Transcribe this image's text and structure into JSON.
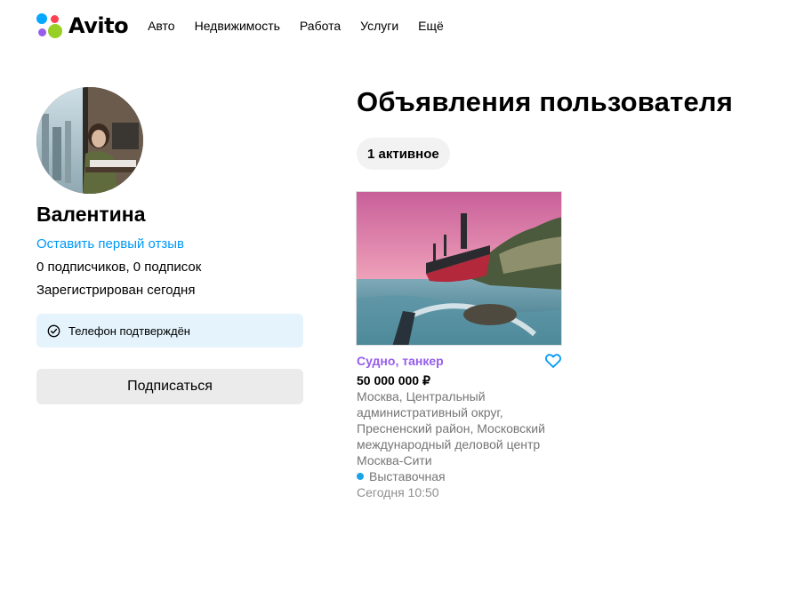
{
  "header": {
    "logo_text": "Avito",
    "nav": [
      "Авто",
      "Недвижимость",
      "Работа",
      "Услуги",
      "Ещё"
    ]
  },
  "profile": {
    "name": "Валентина",
    "review_link": "Оставить первый отзыв",
    "subscribers": "0 подписчиков, 0 подписок",
    "registered": "Зарегистрирован сегодня",
    "phone_verified": "Телефон подтверждён",
    "subscribe_button": "Подписаться"
  },
  "listings": {
    "title": "Объявления пользователя",
    "active_tab": "1 активное",
    "items": [
      {
        "title": "Судно, танкер",
        "price": "50 000 000 ₽",
        "address": "Москва, Центральный административный округ, Пресненский район, Московский международный деловой центр Москва-Сити",
        "metro": "Выставочная",
        "date": "Сегодня 10:50",
        "image_icon": "ship-photo"
      }
    ]
  },
  "colors": {
    "link_blue": "#0099f7",
    "item_title_purple": "#965eeb",
    "phone_box_bg": "#e4f3fc",
    "button_bg": "#ebebeb",
    "metro_dot": "#1aa3e8"
  }
}
